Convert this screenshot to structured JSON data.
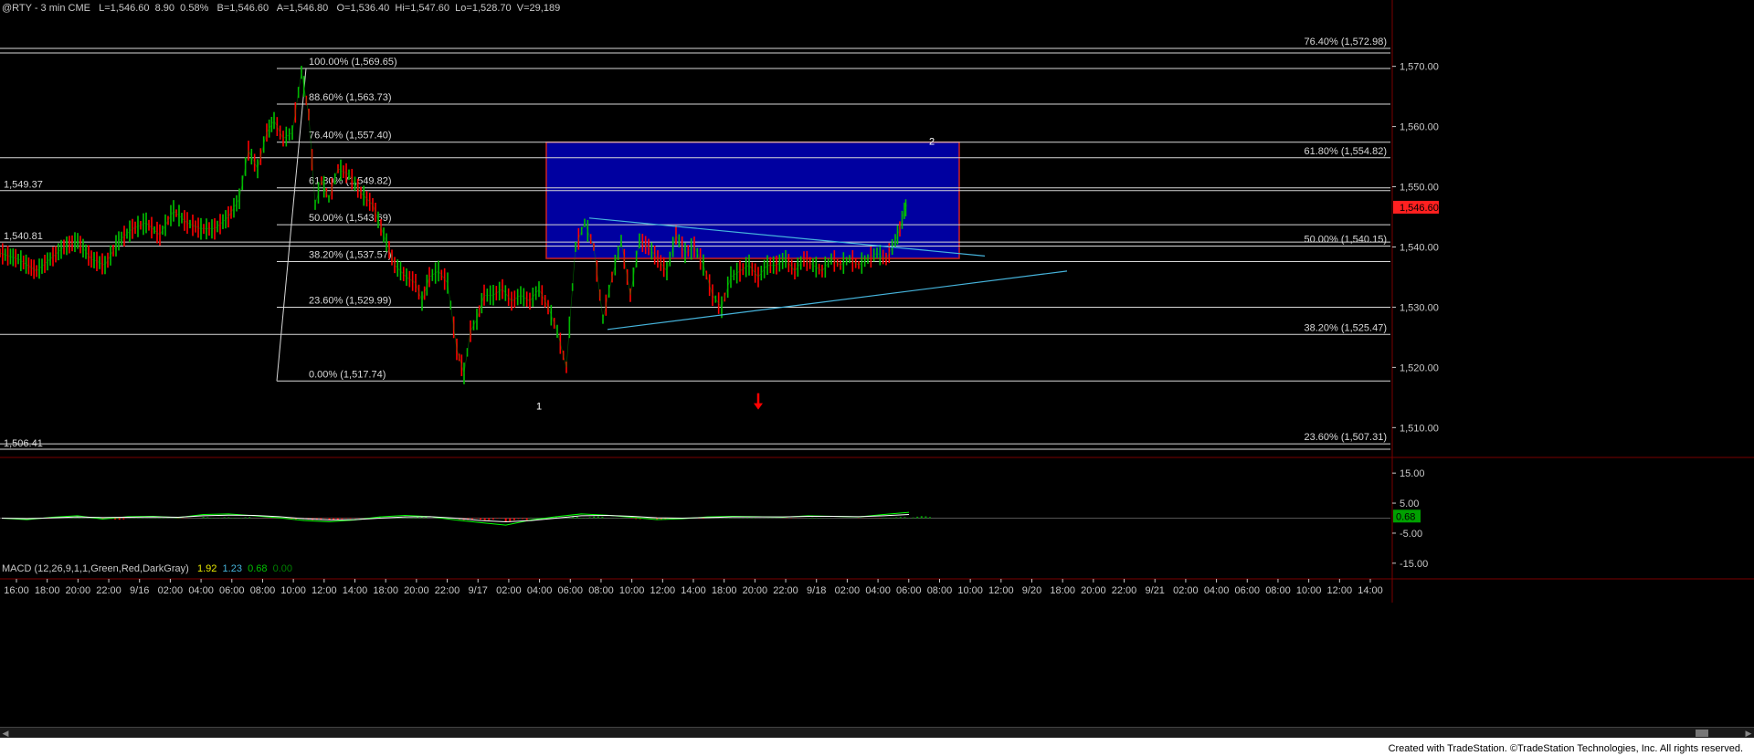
{
  "header": {
    "symbol": "@RTY - 3 min  CME",
    "last": "L=1,546.60",
    "change": "8.90",
    "change_pct": "0.58%",
    "bid": "B=1,546.60",
    "ask": "A=1,546.80",
    "open": "O=1,536.40",
    "high": "Hi=1,547.60",
    "low": "Lo=1,528.70",
    "volume": "V=29,189"
  },
  "macd_header": {
    "label": "MACD (12,26,9,1,1,Green,Red,DarkGray)",
    "v1": "1.92",
    "v2": "1.23",
    "v3": "0.68",
    "v4": "0.00"
  },
  "footer": {
    "credit": "Created with TradeStation. ©TradeStation Technologies, Inc. All rights reserved."
  },
  "colors": {
    "background": "#000000",
    "up": "#00c000",
    "down": "#ff0000",
    "fib_line": "#d8d8d8",
    "box_fill": "#0000a0",
    "box_border": "#cc2222",
    "trendline": "#46b4dc",
    "macd_line": "#00ff00",
    "macd_signal": "#ffffff",
    "price_marker": "#ff2020"
  },
  "chart_data": [
    {
      "type": "line",
      "price_axis": {
        "ylim": [
          1505.5,
          1579.5
        ],
        "ticks": [
          1510,
          1520,
          1530,
          1540,
          1550,
          1560,
          1570
        ],
        "tick_labels": [
          "1,510.00",
          "1,520.00",
          "1,530.00",
          "1,540.00",
          "1,550.00",
          "1,560.00",
          "1,570.00"
        ],
        "last_price_label": "1,546.60",
        "last_price": 1546.6
      },
      "time_axis": {
        "labels": [
          "16:00",
          "18:00",
          "20:00",
          "22:00",
          "9/16",
          "02:00",
          "04:00",
          "06:00",
          "08:00",
          "10:00",
          "12:00",
          "14:00",
          "18:00",
          "20:00",
          "22:00",
          "9/17",
          "02:00",
          "04:00",
          "06:00",
          "08:00",
          "10:00",
          "12:00",
          "14:00",
          "18:00",
          "20:00",
          "22:00",
          "9/18",
          "02:00",
          "04:00",
          "06:00",
          "08:00",
          "10:00",
          "12:00",
          "9/20",
          "18:00",
          "20:00",
          "22:00",
          "9/21",
          "02:00",
          "04:00",
          "06:00",
          "08:00",
          "10:00",
          "12:00",
          "14:00"
        ]
      },
      "series": [
        {
          "values_t": [
            0,
            20,
            40,
            55,
            70,
            85,
            100,
            115,
            130,
            145,
            160,
            175,
            190,
            205,
            220,
            235,
            250,
            262,
            272,
            282,
            292,
            300,
            310,
            320,
            330,
            338,
            345,
            352,
            360,
            370,
            382,
            395,
            408,
            420,
            432,
            445,
            455,
            462,
            470,
            480,
            490,
            500,
            508,
            515,
            522,
            530,
            540,
            550,
            560,
            570,
            580,
            590,
            600,
            610,
            620,
            630,
            640,
            650,
            660,
            670,
            680,
            690,
            700,
            710,
            720,
            730,
            740,
            750,
            760,
            770,
            780,
            790,
            800,
            810,
            820,
            830,
            840,
            850,
            860,
            870,
            880,
            890,
            900,
            910,
            920,
            930,
            940,
            950,
            960,
            970,
            980,
            985,
            990,
            993
          ],
          "values_p": [
            1539,
            1538,
            1536,
            1538,
            1540,
            1541,
            1538,
            1537,
            1541,
            1543,
            1544,
            1542,
            1546,
            1544,
            1543,
            1543,
            1545,
            1548,
            1556,
            1553,
            1559,
            1561,
            1558,
            1559,
            1569,
            1562,
            1547,
            1551,
            1548,
            1553,
            1552,
            1549,
            1547,
            1542,
            1537,
            1535,
            1534,
            1531,
            1535,
            1536,
            1534,
            1523,
            1519,
            1526,
            1528,
            1532,
            1532,
            1533,
            1531,
            1532,
            1531,
            1533,
            1530,
            1526,
            1520,
            1540,
            1544,
            1540,
            1528,
            1535,
            1541,
            1532,
            1541,
            1540,
            1538,
            1536,
            1542,
            1539,
            1540,
            1537,
            1532,
            1530,
            1535,
            1536,
            1537,
            1535,
            1537,
            1537,
            1538,
            1536,
            1538,
            1537,
            1536,
            1538,
            1537,
            1538,
            1537,
            1538,
            1539,
            1538,
            1541,
            1543,
            1546,
            1547
          ]
        }
      ],
      "fib_left": [
        {
          "label": "100.00% (1,569.65)",
          "value": 1569.65
        },
        {
          "label": "88.60% (1,563.73)",
          "value": 1563.73
        },
        {
          "label": "76.40% (1,557.40)",
          "value": 1557.4
        },
        {
          "label": "61.80% (1,549.82)",
          "value": 1549.82
        },
        {
          "label": "50.00% (1,543.69)",
          "value": 1543.69
        },
        {
          "label": "38.20% (1,537.57)",
          "value": 1537.57
        },
        {
          "label": "23.60% (1,529.99)",
          "value": 1529.99
        },
        {
          "label": "0.00% (1,517.74)",
          "value": 1517.74
        }
      ],
      "fib_right": [
        {
          "label": "76.40% (1,572.98)",
          "value": 1572.98
        },
        {
          "label": "61.80% (1,554.82)",
          "value": 1554.82
        },
        {
          "label": "50.00% (1,540.15)",
          "value": 1540.15
        },
        {
          "label": "38.20% (1,525.47)",
          "value": 1525.47
        },
        {
          "label": "23.60% (1,507.31)",
          "value": 1507.31
        }
      ],
      "level_labels": [
        {
          "label": "1,549.37",
          "value": 1549.37
        },
        {
          "label": "1,540.81",
          "value": 1540.81
        },
        {
          "label": "1,506.41",
          "value": 1506.41
        }
      ],
      "wave_labels": [
        {
          "label": "1",
          "t": 590,
          "value": 1513
        },
        {
          "label": "2",
          "t": 1020,
          "value": 1557
        }
      ],
      "target_box": {
        "t_start": 598,
        "t_end": 1050,
        "top": 1557.4,
        "bottom": 1538.1
      },
      "trendlines": [
        {
          "t1": 645,
          "p1": 1544.8,
          "t2": 1078,
          "p2": 1538.5
        },
        {
          "t1": 665,
          "p1": 1526.3,
          "t2": 1168,
          "p2": 1536.0
        }
      ],
      "down_arrow": {
        "t": 830,
        "value": 1514.5
      }
    },
    {
      "type": "line",
      "title": "MACD",
      "ylim": [
        -19,
        19
      ],
      "ticks": [
        15,
        5,
        -5,
        -15
      ],
      "tick_labels": [
        "15.00",
        "5.00",
        "-5.00",
        "-15.00"
      ],
      "last_label": "0.68",
      "last_value": 0.68,
      "series": [
        {
          "name": "MACD",
          "values": [
            0,
            -0.5,
            0.3,
            0.8,
            -0.3,
            0.5,
            0.6,
            0.2,
            1.2,
            1.4,
            0.8,
            0.1,
            -0.8,
            -1.2,
            -0.6,
            0.4,
            0.9,
            0.5,
            -0.6,
            -1.5,
            -2.3,
            -0.6,
            0.5,
            1.4,
            1.0,
            0.3,
            -0.5,
            -0.2,
            0.4,
            0.6,
            0.5,
            0.3,
            0.8,
            0.6,
            0.4,
            1.2,
            1.92
          ]
        },
        {
          "name": "Signal",
          "values": [
            0,
            -0.2,
            0.1,
            0.4,
            0.2,
            0.3,
            0.4,
            0.3,
            0.8,
            1.0,
            0.9,
            0.5,
            -0.2,
            -0.6,
            -0.5,
            0.0,
            0.4,
            0.5,
            0.0,
            -0.8,
            -1.2,
            -0.8,
            0.0,
            0.8,
            0.9,
            0.6,
            0.1,
            0.0,
            0.2,
            0.4,
            0.4,
            0.4,
            0.6,
            0.6,
            0.5,
            0.8,
            1.23
          ]
        }
      ]
    }
  ]
}
